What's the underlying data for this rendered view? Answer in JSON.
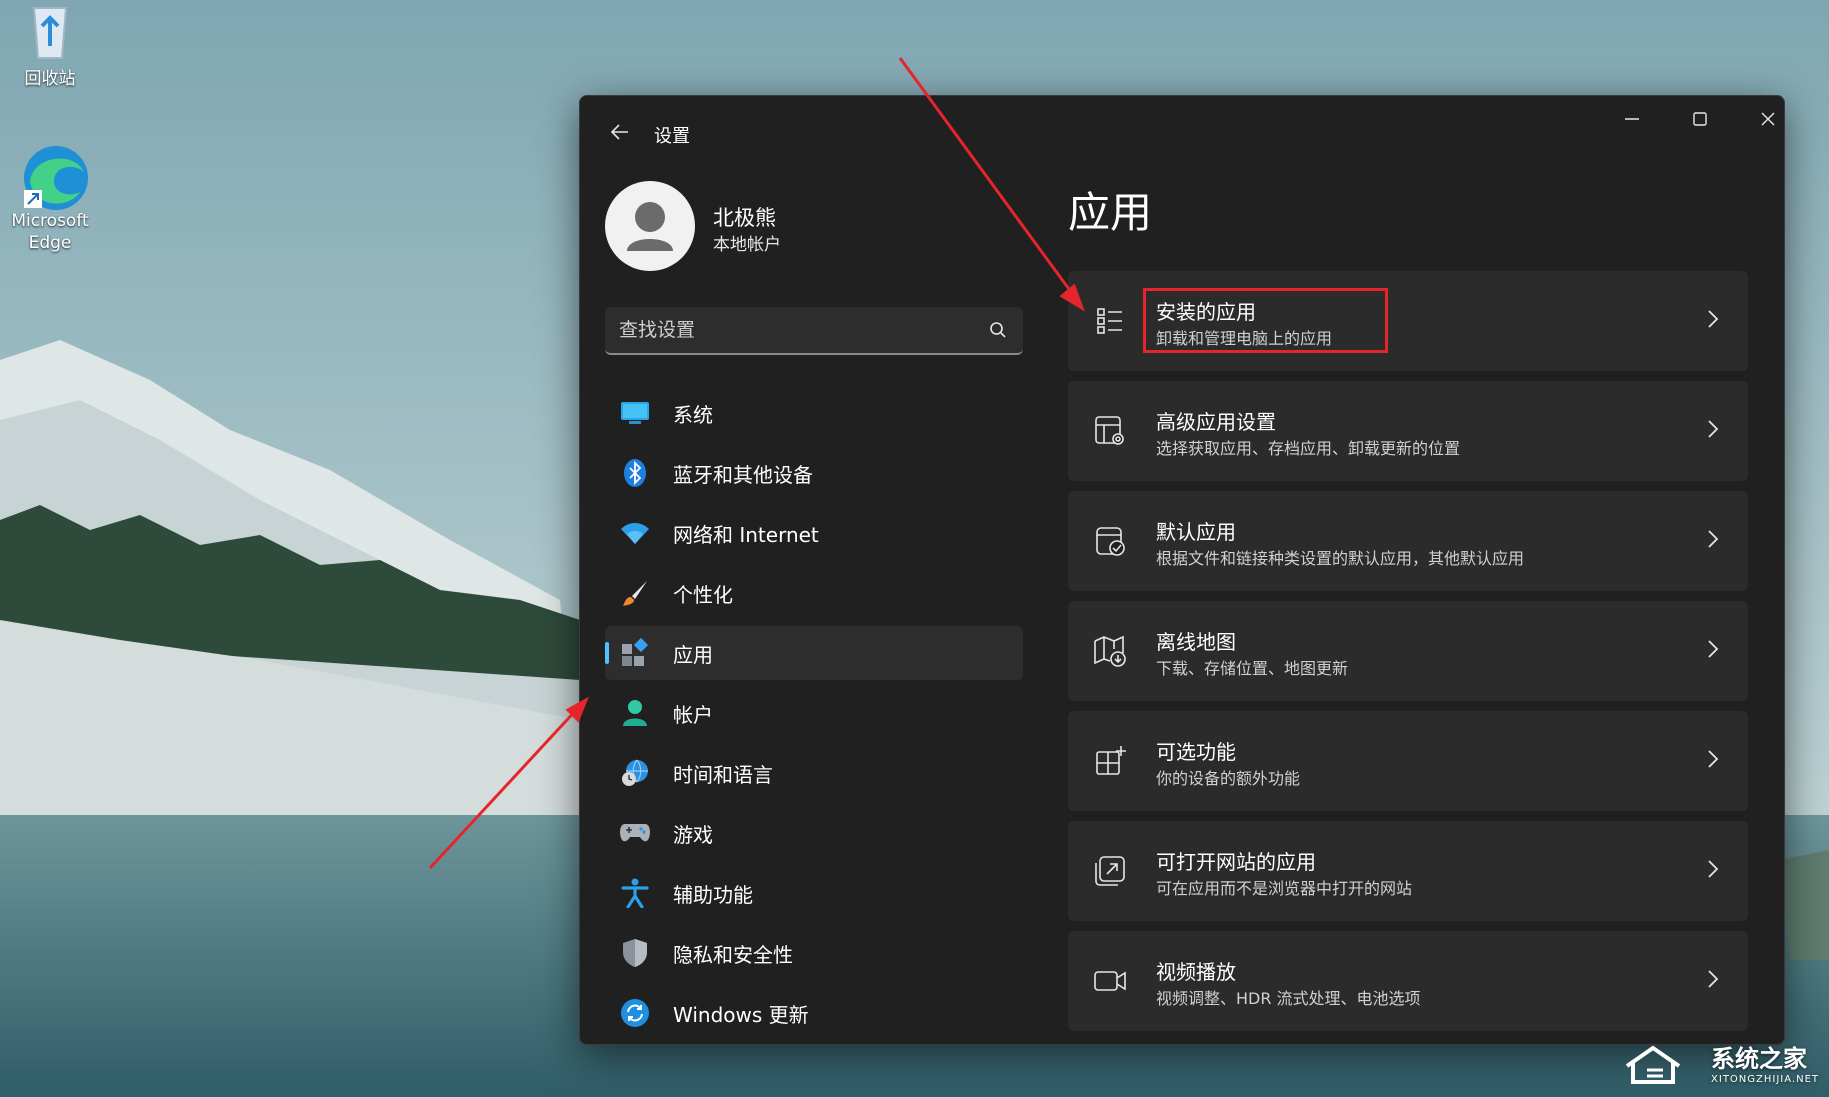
{
  "desktop": {
    "icons": [
      {
        "label": "回收站",
        "icon": "recycle-bin-icon"
      },
      {
        "label": "Microsoft Edge",
        "icon": "edge-icon"
      }
    ]
  },
  "window": {
    "title": "设置",
    "controls": [
      "minimize-icon",
      "maximize-icon",
      "close-icon"
    ]
  },
  "profile": {
    "name": "北极熊",
    "account_type": "本地帐户"
  },
  "search": {
    "placeholder": "查找设置"
  },
  "nav": {
    "items": [
      {
        "label": "系统",
        "icon": "system-icon"
      },
      {
        "label": "蓝牙和其他设备",
        "icon": "bluetooth-icon"
      },
      {
        "label": "网络和 Internet",
        "icon": "wifi-icon"
      },
      {
        "label": "个性化",
        "icon": "brush-icon"
      },
      {
        "label": "应用",
        "icon": "apps-icon",
        "selected": true
      },
      {
        "label": "帐户",
        "icon": "account-icon"
      },
      {
        "label": "时间和语言",
        "icon": "globe-clock-icon"
      },
      {
        "label": "游戏",
        "icon": "gamepad-icon"
      },
      {
        "label": "辅助功能",
        "icon": "accessibility-icon"
      },
      {
        "label": "隐私和安全性",
        "icon": "shield-icon"
      },
      {
        "label": "Windows 更新",
        "icon": "update-icon"
      }
    ]
  },
  "main": {
    "title": "应用",
    "cards": [
      {
        "title": "安装的应用",
        "subtitle": "卸载和管理电脑上的应用",
        "icon": "list-icon"
      },
      {
        "title": "高级应用设置",
        "subtitle": "选择获取应用、存档应用、卸载更新的位置",
        "icon": "app-settings-icon"
      },
      {
        "title": "默认应用",
        "subtitle": "根据文件和链接种类设置的默认应用，其他默认应用",
        "icon": "default-apps-icon"
      },
      {
        "title": "离线地图",
        "subtitle": "下载、存储位置、地图更新",
        "icon": "map-icon"
      },
      {
        "title": "可选功能",
        "subtitle": "你的设备的额外功能",
        "icon": "optional-features-icon"
      },
      {
        "title": "可打开网站的应用",
        "subtitle": "可在应用而不是浏览器中打开的网站",
        "icon": "open-website-icon"
      },
      {
        "title": "视频播放",
        "subtitle": "视频调整、HDR 流式处理、电池选项",
        "icon": "video-icon"
      }
    ]
  },
  "annotation": {
    "color": "#e5252c"
  },
  "accent": "#4cc2ff",
  "watermark": {
    "name": "系统之家",
    "url": "XITONGZHIJIA.NET"
  }
}
